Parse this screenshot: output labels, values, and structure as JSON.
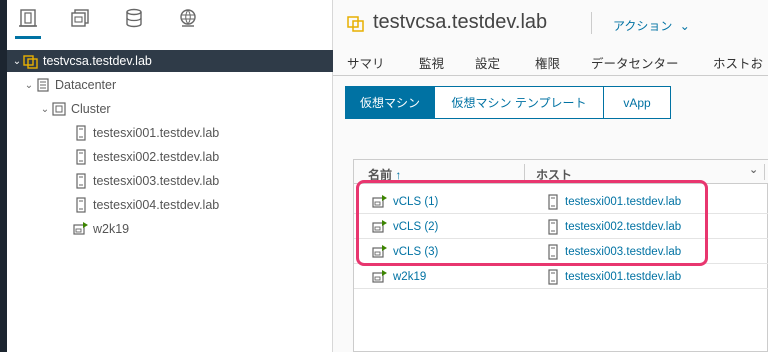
{
  "navigator": {
    "tabs": [
      {
        "icon": "hosts-clusters-icon",
        "active": true
      },
      {
        "icon": "vms-templates-icon",
        "active": false
      },
      {
        "icon": "storage-icon",
        "active": false
      },
      {
        "icon": "networking-icon",
        "active": false
      }
    ],
    "tree": {
      "vcenter": "testvcsa.testdev.lab",
      "datacenter": "Datacenter",
      "cluster": "Cluster",
      "hosts": [
        "testesxi001.testdev.lab",
        "testesxi002.testdev.lab",
        "testesxi003.testdev.lab",
        "testesxi004.testdev.lab"
      ],
      "vm": "w2k19"
    }
  },
  "header": {
    "title": "testvcsa.testdev.lab",
    "actions_label": "アクション"
  },
  "tabs": [
    "サマリ",
    "監視",
    "設定",
    "権限",
    "データセンター",
    "ホストお"
  ],
  "segments": [
    "仮想マシン",
    "仮想マシン テンプレート",
    "vApp"
  ],
  "grid": {
    "col_name": "名前",
    "col_host": "ホスト",
    "rows": [
      {
        "name": "vCLS (1)",
        "host": "testesxi001.testdev.lab"
      },
      {
        "name": "vCLS (2)",
        "host": "testesxi002.testdev.lab"
      },
      {
        "name": "vCLS (3)",
        "host": "testesxi003.testdev.lab"
      },
      {
        "name": "w2k19",
        "host": "testesxi001.testdev.lab"
      }
    ]
  },
  "colors": {
    "accent": "#0072a3",
    "highlight": "#e8366f",
    "selected_row": "#2f3b48"
  }
}
